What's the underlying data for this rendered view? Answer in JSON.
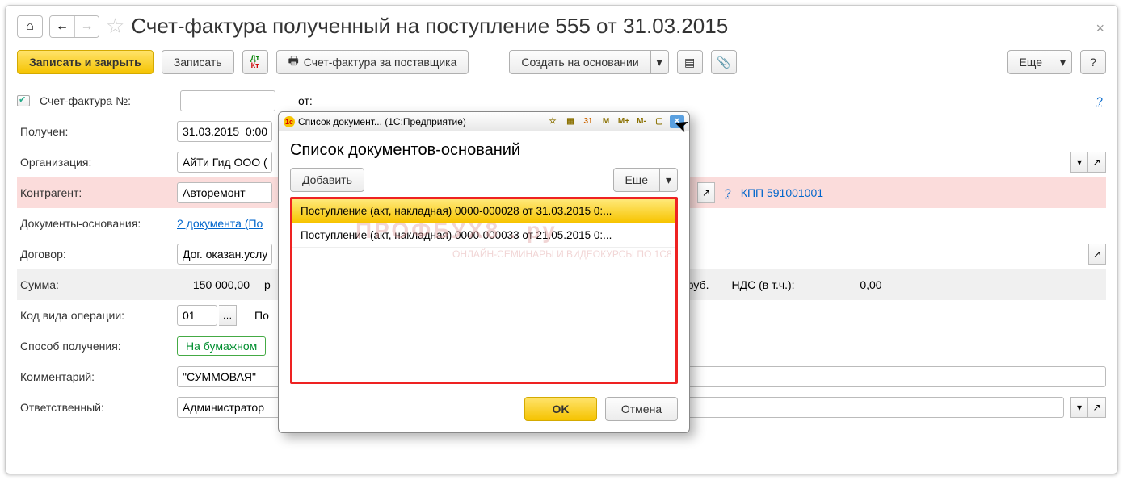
{
  "toolbar": {
    "title": "Счет-фактура полученный на поступление 555 от 31.03.2015",
    "save_close": "Записать и закрыть",
    "save": "Записать",
    "print_invoice": "Счет-фактура за поставщика",
    "create_based": "Создать на основании",
    "more": "Еще",
    "help": "?"
  },
  "fields": {
    "invoice_no_label": "Счет-фактура №:",
    "invoice_no_value": "",
    "from_label": "от:",
    "received_label": "Получен:",
    "received_value": "31.03.2015  0:00",
    "org_label": "Организация:",
    "org_value": "АйТи Гид ООО (",
    "counterparty_label": "Контрагент:",
    "counterparty_value": "Авторемонт",
    "kpp_link": "КПП 591001001",
    "basis_label": "Документы-основания:",
    "basis_link": "2 документа (По",
    "contract_label": "Договор:",
    "contract_value": "Дог. оказан.услу",
    "sum_label": "Сумма:",
    "sum_value": "150 000,00",
    "sum_currency": "руб.",
    "vat_label": "НДС (в т.ч.):",
    "vat_value": "0,00",
    "opcode_label": "Код вида операции:",
    "opcode_value": "01",
    "opcode_desc": "По",
    "method_label": "Способ получения:",
    "method_value": "На бумажном",
    "comment_label": "Комментарий:",
    "comment_value": "\"СУММОВАЯ\" ",
    "responsible_label": "Ответственный:",
    "responsible_value": "Администратор"
  },
  "modal": {
    "app_title": "Список документ...  (1С:Предприятие)",
    "heading": "Список документов-оснований",
    "add": "Добавить",
    "more": "Еще",
    "ok": "OK",
    "cancel": "Отмена",
    "rows": [
      "Поступление (акт, накладная) 0000-000028 от 31.03.2015 0:...",
      "Поступление (акт, накладная) 0000-000033 от 21.05.2015 0:..."
    ],
    "tb_buttons": [
      "M",
      "M+",
      "M-"
    ]
  },
  "watermark": "ПРОФБУХ8 . ру",
  "watermark_sub": "ОНЛАЙН-СЕМИНАРЫ И ВИДЕОКУРСЫ ПО 1С8"
}
